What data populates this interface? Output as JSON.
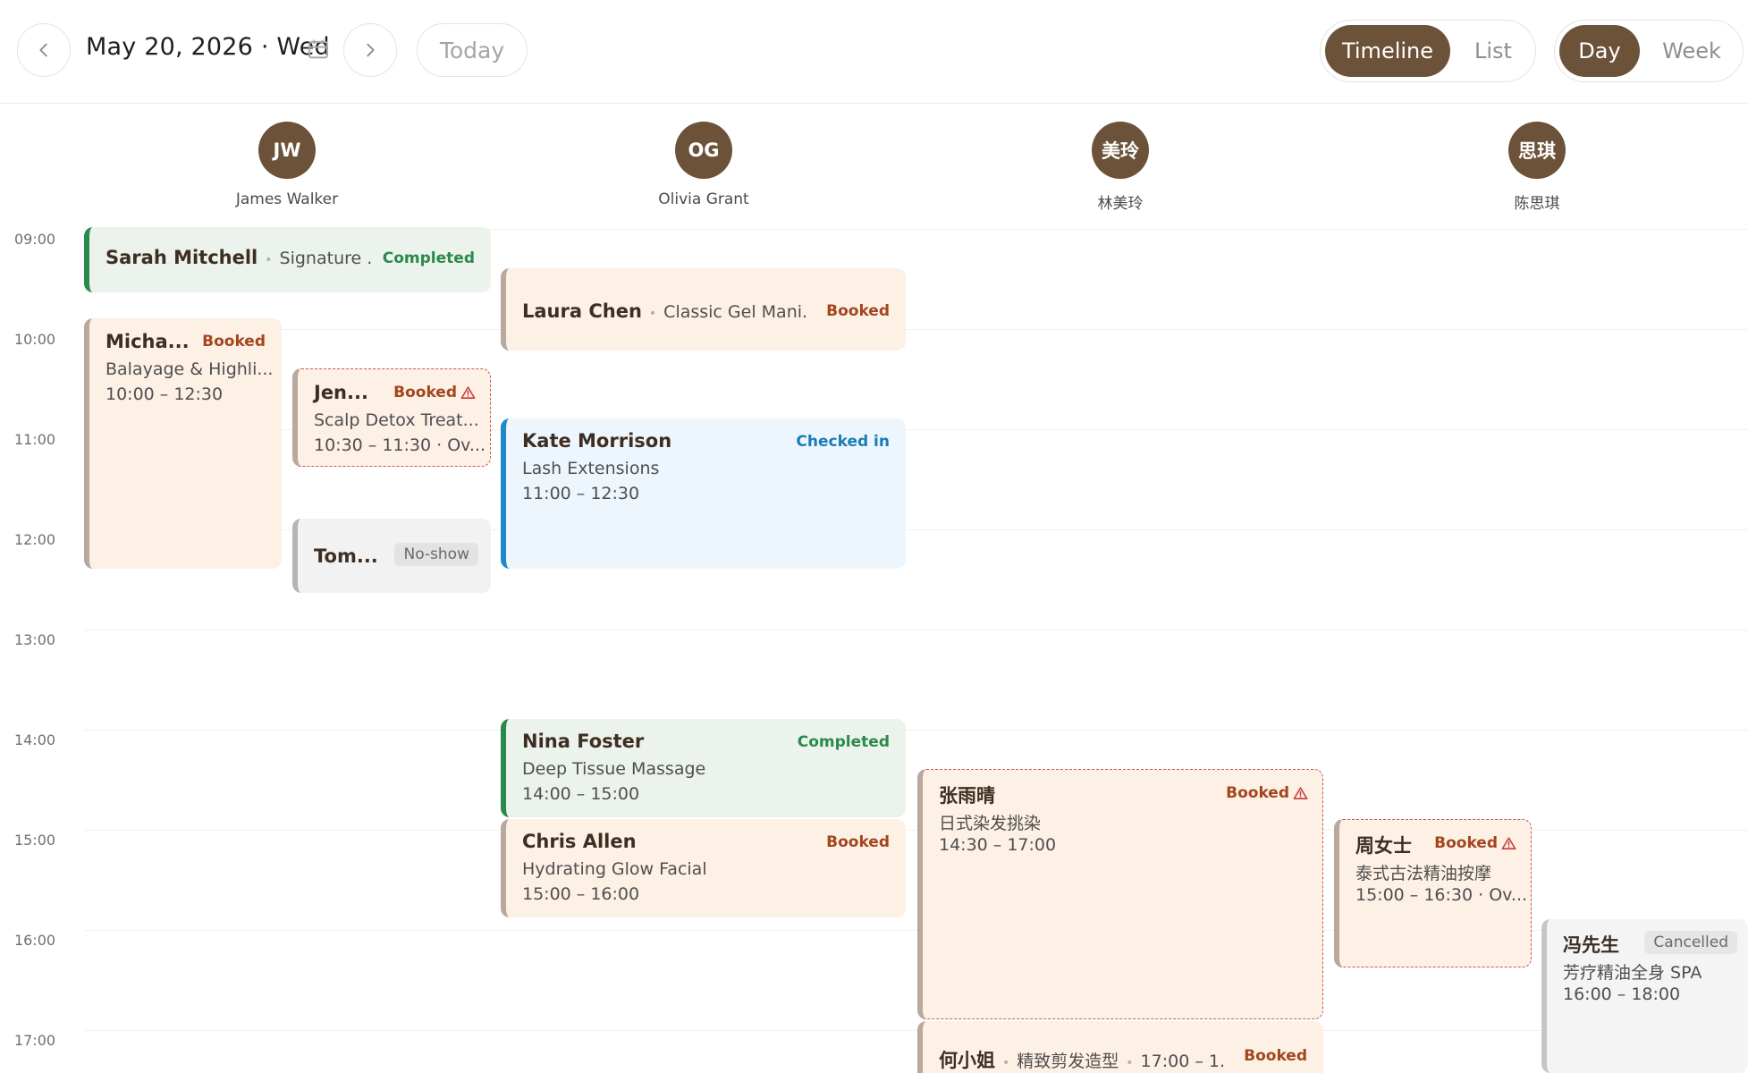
{
  "header": {
    "date": "May 20, 2026 · Wed",
    "today_label": "Today",
    "view_mode": {
      "timeline": "Timeline",
      "list": "List",
      "active": "Timeline"
    },
    "range": {
      "day": "Day",
      "week": "Week",
      "active": "Day"
    }
  },
  "staff": [
    {
      "initials": "JW",
      "name": "James Walker"
    },
    {
      "initials": "OG",
      "name": "Olivia Grant"
    },
    {
      "initials": "美玲",
      "name": "林美玲"
    },
    {
      "initials": "思琪",
      "name": "陈思琪"
    }
  ],
  "hours": [
    "09:00",
    "10:00",
    "11:00",
    "12:00",
    "13:00",
    "14:00",
    "15:00",
    "16:00",
    "17:00"
  ],
  "appointments": [
    {
      "client": "Sarah Mitchell",
      "service": "Signature ...",
      "status": "Completed"
    },
    {
      "client": "Laura Chen",
      "service": "Classic Gel Mani...",
      "status": "Booked"
    },
    {
      "client": "Micha...",
      "service": "Balayage & Highli...",
      "time": "10:00 – 12:30",
      "status": "Booked"
    },
    {
      "client": "Jen...",
      "service": "Scalp Detox Treat...",
      "time": "10:30 – 11:30 · Ov...",
      "status": "Booked"
    },
    {
      "client": "Kate Morrison",
      "service": "Lash Extensions",
      "time": "11:00 – 12:30",
      "status": "Checked in"
    },
    {
      "client": "Tom...",
      "status": "No-show"
    },
    {
      "client": "Nina Foster",
      "service": "Deep Tissue Massage",
      "time": "14:00 – 15:00",
      "status": "Completed"
    },
    {
      "client": "Chris Allen",
      "service": "Hydrating Glow Facial",
      "time": "15:00 – 16:00",
      "status": "Booked"
    },
    {
      "client": "张雨晴",
      "service": "日式染发挑染",
      "time": "14:30 – 17:00",
      "status": "Booked"
    },
    {
      "client": "周女士",
      "service": "泰式古法精油按摩",
      "time": "15:00 – 16:30 · Ov...",
      "status": "Booked"
    },
    {
      "client": "冯先生",
      "service": "芳疗精油全身 SPA",
      "time": "16:00 – 18:00",
      "status": "Cancelled"
    },
    {
      "client": "何小姐",
      "service": "精致剪发造型",
      "time": "17:00 – 1...",
      "status": "Booked"
    }
  ]
}
